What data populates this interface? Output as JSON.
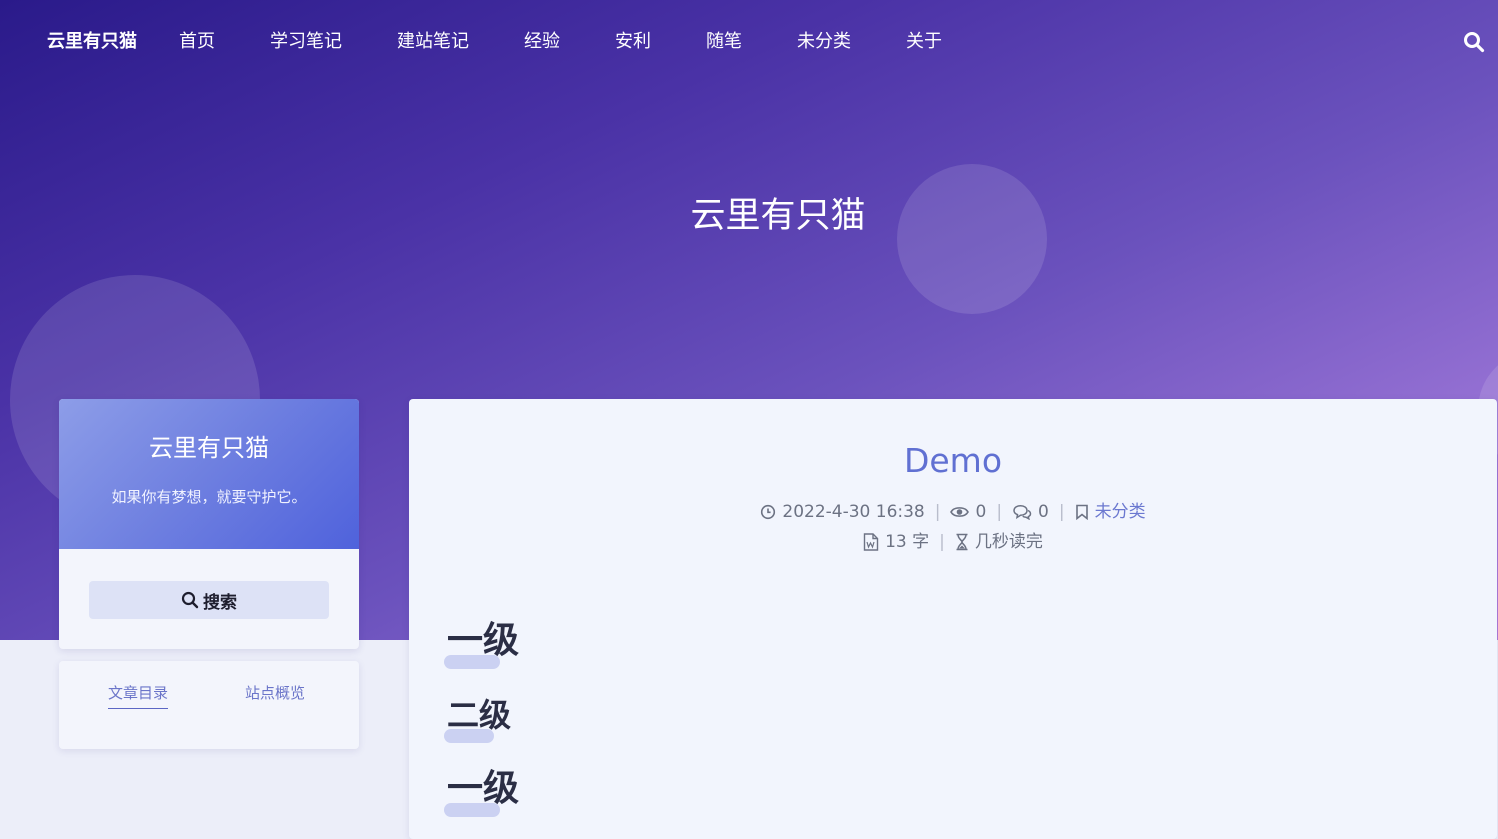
{
  "nav": {
    "brand": "云里有只猫",
    "items": [
      {
        "label": "首页"
      },
      {
        "label": "学习笔记"
      },
      {
        "label": "建站笔记"
      },
      {
        "label": "经验"
      },
      {
        "label": "安利"
      },
      {
        "label": "随笔"
      },
      {
        "label": "未分类"
      },
      {
        "label": "关于"
      }
    ],
    "search_icon": "search-icon"
  },
  "hero": {
    "title": "云里有只猫"
  },
  "sidebar": {
    "site_name": "云里有只猫",
    "motto": "如果你有梦想，就要守护它。",
    "search_label": "搜索",
    "tabs": [
      {
        "label": "文章目录",
        "active": true
      },
      {
        "label": "站点概览",
        "active": false
      }
    ]
  },
  "post": {
    "title": "Demo",
    "date": "2022-4-30 16:38",
    "views": "0",
    "comments": "0",
    "category": "未分类",
    "word_count": "13 字",
    "read_time": "几秒读完",
    "headings": [
      {
        "text": "一级"
      },
      {
        "text": "二级"
      },
      {
        "text": "一级"
      }
    ]
  },
  "colors": {
    "accent": "#6070d2",
    "hero_start": "#2a1a8a",
    "hero_end": "#b07ad8",
    "text_dark": "#2b2e45"
  }
}
